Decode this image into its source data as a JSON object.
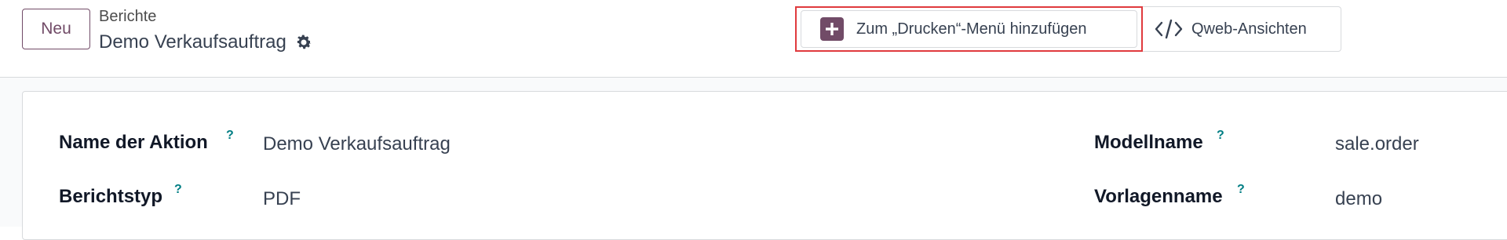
{
  "control_panel": {
    "new_button": "Neu",
    "breadcrumb": "Berichte",
    "record_title": "Demo Verkaufsauftrag",
    "gear_icon": "gear-icon",
    "print_menu_button": "Zum „Drucken“-Menü hinzufügen",
    "qweb_button": "Qweb-Ansichten"
  },
  "form": {
    "fields": [
      {
        "label": "Name der Aktion",
        "help": "?",
        "value": "Demo Verkaufsauftrag"
      },
      {
        "label": "Berichtstyp",
        "help": "?",
        "value": "PDF"
      },
      {
        "label": "Modellname",
        "help": "?",
        "value": "sale.order"
      },
      {
        "label": "Vorlagenname",
        "help": "?",
        "value": "demo"
      }
    ]
  },
  "colors": {
    "brand": "#714b67",
    "highlight": "#e03a3e",
    "help": "#017e84"
  }
}
